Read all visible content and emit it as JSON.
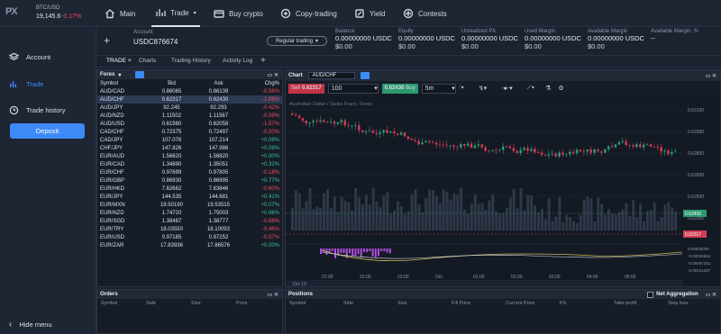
{
  "ticker": {
    "symbol": "BTC/USD",
    "price": "19,145.6",
    "change": "-0.17%"
  },
  "nav": {
    "main": "Main",
    "trade": "Trade",
    "buy_crypto": "Buy crypto",
    "copy": "Copy-trading",
    "yield": "Yield",
    "contests": "Contests"
  },
  "sidebar": {
    "account": "Account",
    "trade": "Trade",
    "trade_history": "Trade history",
    "deposit": "Deposit",
    "hide_menu": "Hide menu"
  },
  "account": {
    "label": "Account",
    "id": "USDC876674",
    "mode": "Regular trading"
  },
  "stats": [
    {
      "label": "Balance",
      "value": "0.00000000 USDC",
      "sub": "$0.00"
    },
    {
      "label": "Equity",
      "value": "0.00000000 USDC",
      "sub": "$0.00"
    },
    {
      "label": "Unrealized P/L",
      "value": "0.00000000 USDC",
      "sub": "$0.00"
    },
    {
      "label": "Used Margin",
      "value": "0.00000000 USDC",
      "sub": "$0.00"
    },
    {
      "label": "Available Margin",
      "value": "0.00000000 USDC",
      "sub": "$0.00"
    },
    {
      "label": "Available Margin, %",
      "value": "--",
      "sub": ""
    }
  ],
  "tabs": {
    "trade": "TRADE",
    "charts": "Charts",
    "history": "Trading History",
    "activity": "Activity Log"
  },
  "forex": {
    "title": "Forex",
    "headers": [
      "Symbol",
      "Bid",
      "Ask",
      "Chg%"
    ],
    "rows": [
      [
        "AUD/CAD",
        "0.86065",
        "0.86139",
        "-0.56%"
      ],
      [
        "AUD/CHF",
        "0.62317",
        "0.62430",
        "-1.08%"
      ],
      [
        "AUD/JPY",
        "92.245",
        "92.293",
        "-0.42%"
      ],
      [
        "AUD/NZD",
        "1.11502",
        "1.11567",
        "-0.08%"
      ],
      [
        "AUD/USD",
        "0.61980",
        "0.62058",
        "-1.57%"
      ],
      [
        "CAD/CHF",
        "0.72375",
        "0.72497",
        "-0.50%"
      ],
      [
        "CAD/JPY",
        "107.076",
        "107.214",
        "+0.08%"
      ],
      [
        "CHF/JPY",
        "147.826",
        "147.986",
        "+0.59%"
      ],
      [
        "EUR/AUD",
        "1.56620",
        "1.56820",
        "+0.90%"
      ],
      [
        "EUR/CAD",
        "1.34890",
        "1.35051",
        "+0.32%"
      ],
      [
        "EUR/CHF",
        "0.97699",
        "0.97805",
        "-0.18%"
      ],
      [
        "EUR/GBP",
        "0.86930",
        "0.86995",
        "+0.77%"
      ],
      [
        "EUR/HKD",
        "7.62662",
        "7.63646",
        "-0.60%"
      ],
      [
        "EUR/JPY",
        "144.535",
        "144.681",
        "+0.41%"
      ],
      [
        "EUR/MXN",
        "19.50190",
        "19.53515",
        "+0.07%"
      ],
      [
        "EUR/NZD",
        "1.74720",
        "1.75003",
        "+0.86%"
      ],
      [
        "EUR/SGD",
        "1.38487",
        "1.38777",
        "-0.88%"
      ],
      [
        "EUR/TRY",
        "18.03550",
        "18.10093",
        "-0.46%"
      ],
      [
        "EUR/USD",
        "0.97185",
        "0.97252",
        "-0.57%"
      ],
      [
        "EUR/ZAR",
        "17.83936",
        "17.86576",
        "+0.00%"
      ]
    ]
  },
  "chart": {
    "title": "Chart",
    "symbol": "AUD/CHF",
    "sell_label": "Sell",
    "sell_price": "0.62317",
    "qty": "100",
    "buy_price": "0.62430",
    "buy_label": "Buy",
    "interval": "5m",
    "caption": "Australian Dollar / Swiss Franc, Forex",
    "yticks": [
      "0.63100",
      "0.62950",
      "0.62800",
      "0.62650",
      "0.62500",
      "0.62350"
    ],
    "price_tag_buy": "0.62430",
    "price_tag_sell": "0.62317",
    "osc_ticks": [
      "0.00000000",
      "-0.00036654",
      "-0.00067251",
      "-0.00101297"
    ],
    "xticks": [
      "21:00",
      "22:00",
      "23:00",
      "Oct",
      "01:00",
      "02:00",
      "03:00",
      "04:00",
      "05:00"
    ],
    "date_label": "Oct 13"
  },
  "orders": {
    "title": "Orders",
    "headers": [
      "Symbol",
      "Side",
      "Size",
      "Price"
    ]
  },
  "positions": {
    "title": "Positions",
    "net": "Net Aggregation",
    "headers": [
      "Symbol",
      "Side",
      "Size",
      "Fill Price",
      "Current Price",
      "P/L",
      "Take profit",
      "Stop loss"
    ]
  }
}
